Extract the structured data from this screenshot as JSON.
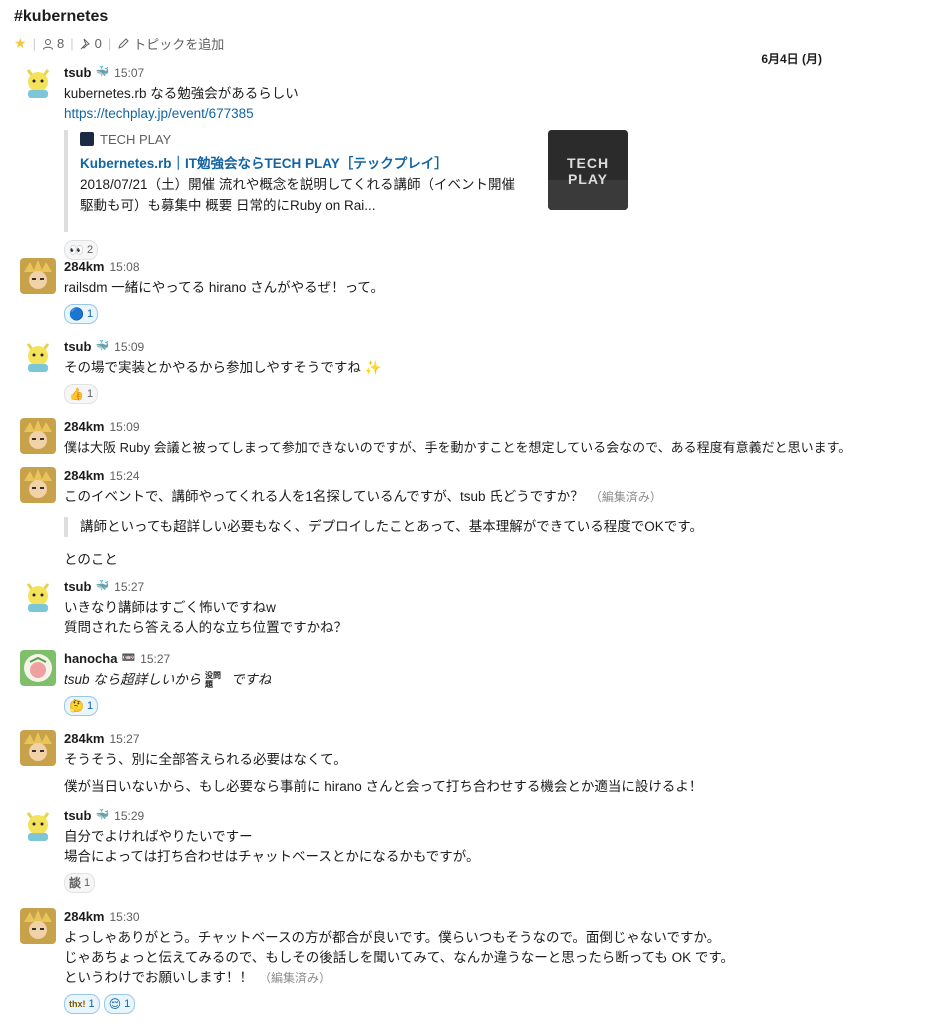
{
  "channel": {
    "name": "#kubernetes",
    "members": "8",
    "pins": "0",
    "topic_label": "トピックを追加"
  },
  "date_divider": "6月4日 (月)",
  "messages": [
    {
      "author": "tsub",
      "time": "15:07",
      "line1": "kubernetes.rb なる勉強会があるらしい",
      "link": "https://techplay.jp/event/677385",
      "unfurl": {
        "site": "TECH PLAY",
        "title": "Kubernetes.rb｜IT勉強会ならTECH PLAY［テックプレイ］",
        "desc1": "2018/07/21（土）開催 流れや概念を説明してくれる講師（イベント開催",
        "desc2": "駆動も可）も募集中 概要 日常的にRuby on Rai...",
        "thumb_line1": "TECH",
        "thumb_line2": "PLAY"
      },
      "reactions": [
        {
          "emoji": "👀",
          "count": "2"
        }
      ]
    },
    {
      "author": "284km",
      "time": "15:08",
      "line1": "railsdm 一緒にやってる hirano さんがやるぜ！って。",
      "reactions": [
        {
          "emoji": "🔵",
          "count": "1"
        }
      ]
    },
    {
      "author": "tsub",
      "time": "15:09",
      "line1": "その場で実装とかやるから参加しやすそうですね ✨",
      "reactions": [
        {
          "emoji": "👍",
          "count": "1"
        }
      ]
    },
    {
      "author": "284km",
      "time": "15:09",
      "line1": "僕は大阪 Ruby 会議と被ってしまって参加できないのですが、手を動かすことを想定している会なので、ある程度有意義だと思います。"
    },
    {
      "author": "284km",
      "time": "15:24",
      "line1": "このイベントで、講師やってくれる人を1名探しているんですが、tsub 氏どうですか？",
      "edited": "（編集済み）",
      "quote": "講師といっても超詳しい必要もなく、デプロイしたことあって、基本理解ができている程度でOKです。",
      "line_after": "とのこと"
    },
    {
      "author": "tsub",
      "time": "15:27",
      "line1": "いきなり講師はすごく怖いですねw",
      "line2": "質問されたら答える人的な立ち位置ですかね？"
    },
    {
      "author": "hanocha",
      "time": "15:27",
      "line1": "tsub なら超詳しいから",
      "line1_emoji": "没問題",
      "line1_tail": "ですね",
      "reactions": [
        {
          "emoji": "🤔",
          "count": "1"
        }
      ]
    },
    {
      "author": "284km",
      "time": "15:27",
      "line1": "そうそう、別に全部答えられる必要はなくて。",
      "line2": "僕が当日いないから、もし必要なら事前に hirano さんと会って打ち合わせする機会とか適当に設けるよ！"
    },
    {
      "author": "tsub",
      "time": "15:29",
      "line1": "自分でよければやりたいですー",
      "line2": "場合によっては打ち合わせはチャットベースとかになるかもですが。",
      "reactions": [
        {
          "emoji": "談",
          "count": "1"
        }
      ]
    },
    {
      "author": "284km",
      "time": "15:30",
      "line1": "よっしゃありがとう。チャットベースの方が都合が良いです。僕らいつもそうなので。面倒じゃないですか。",
      "line2": "じゃあちょっと伝えてみるので、もしその後話しを聞いてみて、なんか違うなーと思ったら断っても OK です。",
      "line3": "というわけでお願いします！！",
      "edited": "（編集済み）",
      "reactions": [
        {
          "emoji": "thx!",
          "count": "1"
        },
        {
          "emoji": "😌",
          "count": "1"
        }
      ]
    }
  ]
}
